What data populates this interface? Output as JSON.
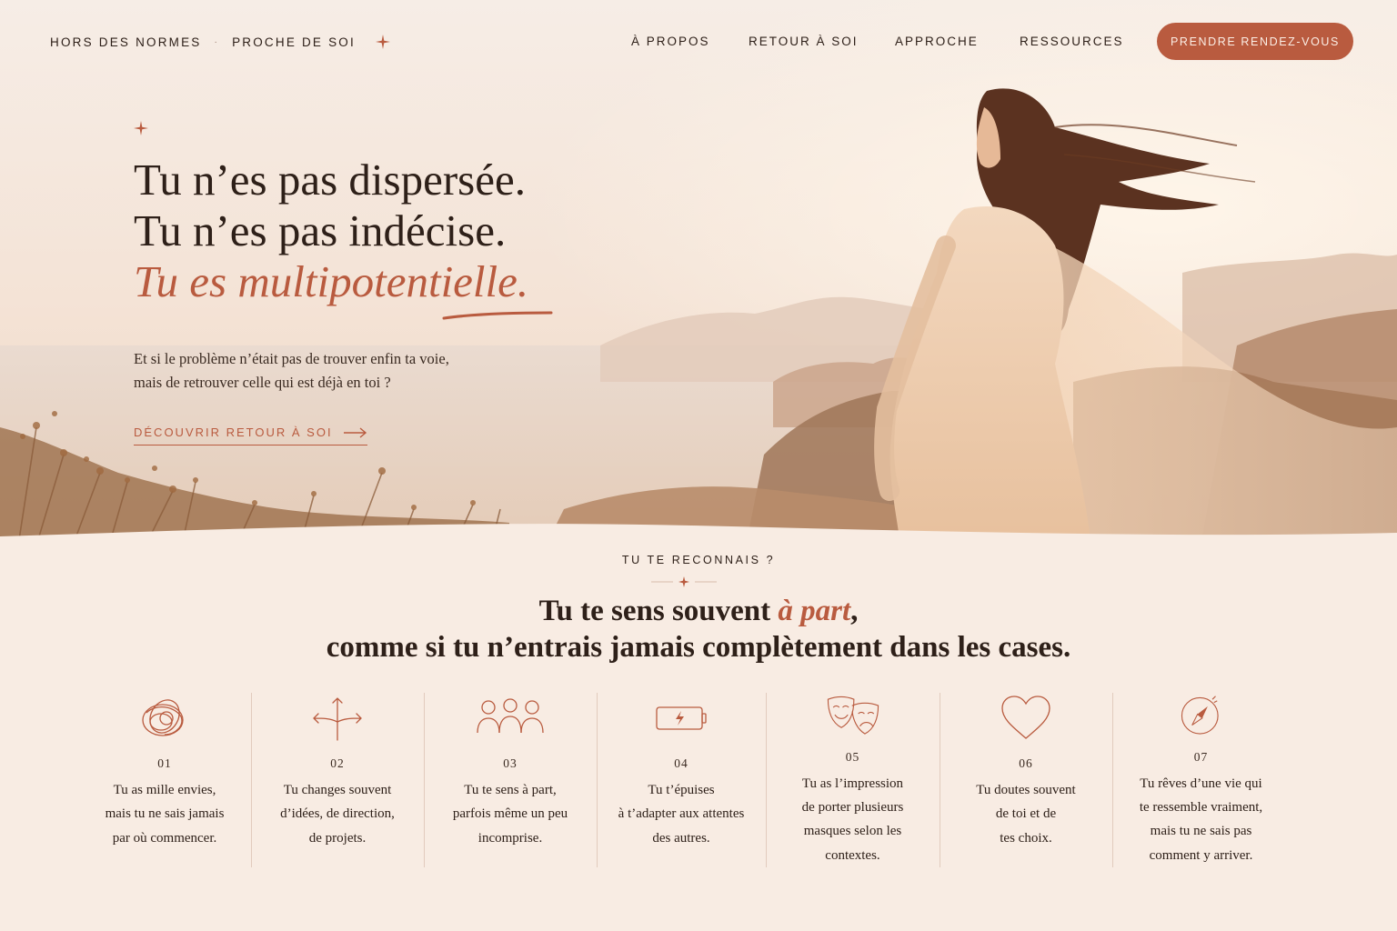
{
  "nav": {
    "brand_left": "HORS DES NORMES",
    "brand_sep": "·",
    "brand_right": "PROCHE DE SOI",
    "links": [
      "À PROPOS",
      "RETOUR À SOI",
      "APPROCHE",
      "RESSOURCES"
    ],
    "cta": "PRENDRE RENDEZ-VOUS"
  },
  "hero": {
    "line1": "Tu n’es pas dispersée.",
    "line2": "Tu n’es pas indécise.",
    "line3": "Tu es multipotentielle.",
    "sub_line1": "Et si le problème n’était pas de trouver enfin ta voie,",
    "sub_line2": "mais de retrouver celle qui est déjà en toi ?",
    "link": "DÉCOUVRIR RETOUR À SOI"
  },
  "section": {
    "eyebrow": "TU TE RECONNAIS ?",
    "title_start": "Tu te sens souvent ",
    "title_accent": "à part",
    "title_end": ",",
    "title_line2": "comme si tu n’entrais jamais complètement dans les cases."
  },
  "features": [
    {
      "num": "01",
      "icon": "tangled-scribble-icon",
      "lines": [
        "Tu as mille envies,",
        "mais tu ne sais jamais",
        "par où commencer."
      ]
    },
    {
      "num": "02",
      "icon": "crossroads-arrows-icon",
      "lines": [
        "Tu changes souvent",
        "d’idées, de direction,",
        "de projets."
      ]
    },
    {
      "num": "03",
      "icon": "group-of-people-icon",
      "lines": [
        "Tu te sens à part,",
        "parfois même un peu",
        "incomprise."
      ]
    },
    {
      "num": "04",
      "icon": "low-battery-icon",
      "lines": [
        "Tu t’épuises",
        "à t’adapter aux attentes",
        "des autres."
      ]
    },
    {
      "num": "05",
      "icon": "theater-masks-icon",
      "lines": [
        "Tu as l’impression",
        "de porter plusieurs",
        "masques selon les",
        "contextes."
      ]
    },
    {
      "num": "06",
      "icon": "heart-icon",
      "lines": [
        "Tu doutes souvent",
        "de toi et de",
        "tes choix."
      ]
    },
    {
      "num": "07",
      "icon": "compass-icon",
      "lines": [
        "Tu rêves d’une vie qui",
        "te ressemble vraiment,",
        "mais tu ne sais pas",
        "comment y arriver."
      ]
    }
  ],
  "colors": {
    "accent": "#b95b3f",
    "background": "#f8ece3",
    "text": "#2e2019",
    "divider": "#e2cbbd"
  }
}
